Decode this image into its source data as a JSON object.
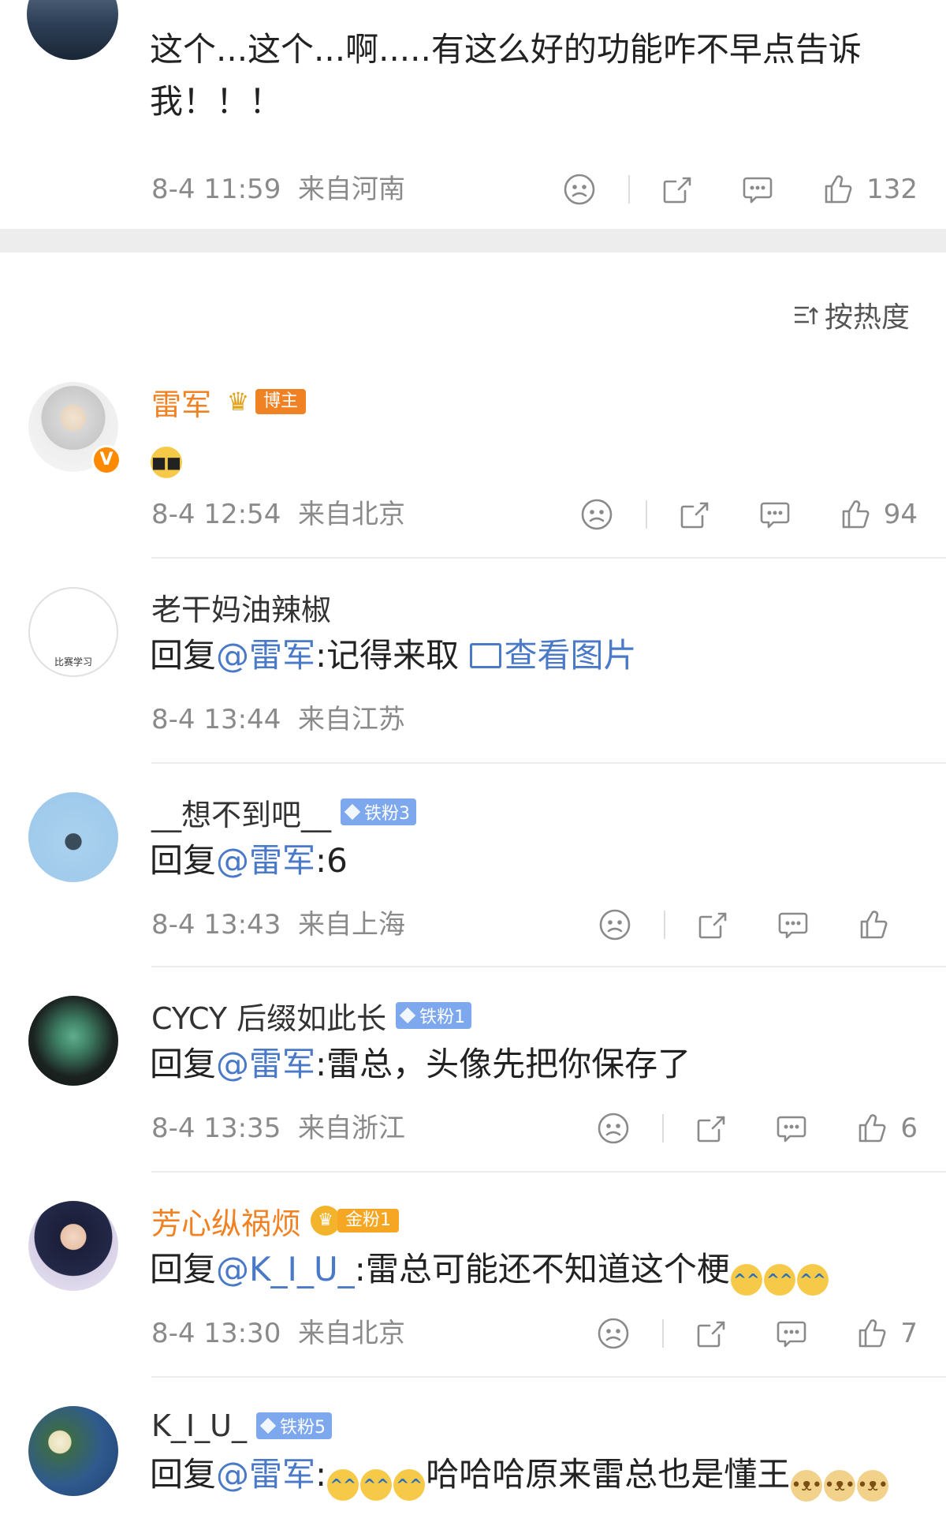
{
  "top_comment": {
    "text": "这个...这个...啊.....有这么好的功能咋不早点告诉我！！！",
    "time": "8-4 11:59",
    "location": "来自河南",
    "like_count": "132"
  },
  "sort": {
    "label": "按热度"
  },
  "comments": [
    {
      "name": "雷军",
      "badge": "博主",
      "body": "😎",
      "time": "8-4 12:54",
      "location": "来自北京",
      "like_count": "94",
      "verified_mark": "V"
    },
    {
      "name": "老干妈油辣椒",
      "avatar_caption": "比赛学习",
      "reply_prefix": "回复",
      "mention": "@雷军",
      "body": ":记得来取",
      "pic_link": "查看图片",
      "time": "8-4 13:44",
      "location": "来自江苏"
    },
    {
      "name": "__想不到吧__",
      "badge": "铁粉3",
      "reply_prefix": "回复",
      "mention": "@雷军",
      "body": ":6",
      "time": "8-4 13:43",
      "location": "来自上海",
      "like_count": ""
    },
    {
      "name": "CYCY 后缀如此长",
      "badge": "铁粉1",
      "reply_prefix": "回复",
      "mention": "@雷军",
      "body": ":雷总，头像先把你保存了",
      "time": "8-4 13:35",
      "location": "来自浙江",
      "like_count": "6"
    },
    {
      "name": "芳心纵祸烦",
      "badge": "金粉1",
      "reply_prefix": "回复",
      "mention": "@K_I_U_",
      "body": ":雷总可能还不知道这个梗",
      "time": "8-4 13:30",
      "location": "来自北京",
      "like_count": "7"
    },
    {
      "name": "K_I_U_",
      "badge": "铁粉5",
      "reply_prefix": "回复",
      "mention": "@雷军",
      "body": ":",
      "body_after": "哈哈哈原来雷总也是懂王"
    }
  ],
  "icons": {
    "dislike": "sad-face-icon",
    "share": "share-icon",
    "comment": "comment-icon",
    "like": "thumbs-up-icon",
    "sort": "sort-icon"
  },
  "colors": {
    "mention": "#4a79c8",
    "host_name": "#f08224",
    "meta_gray": "#8a8a8a"
  }
}
